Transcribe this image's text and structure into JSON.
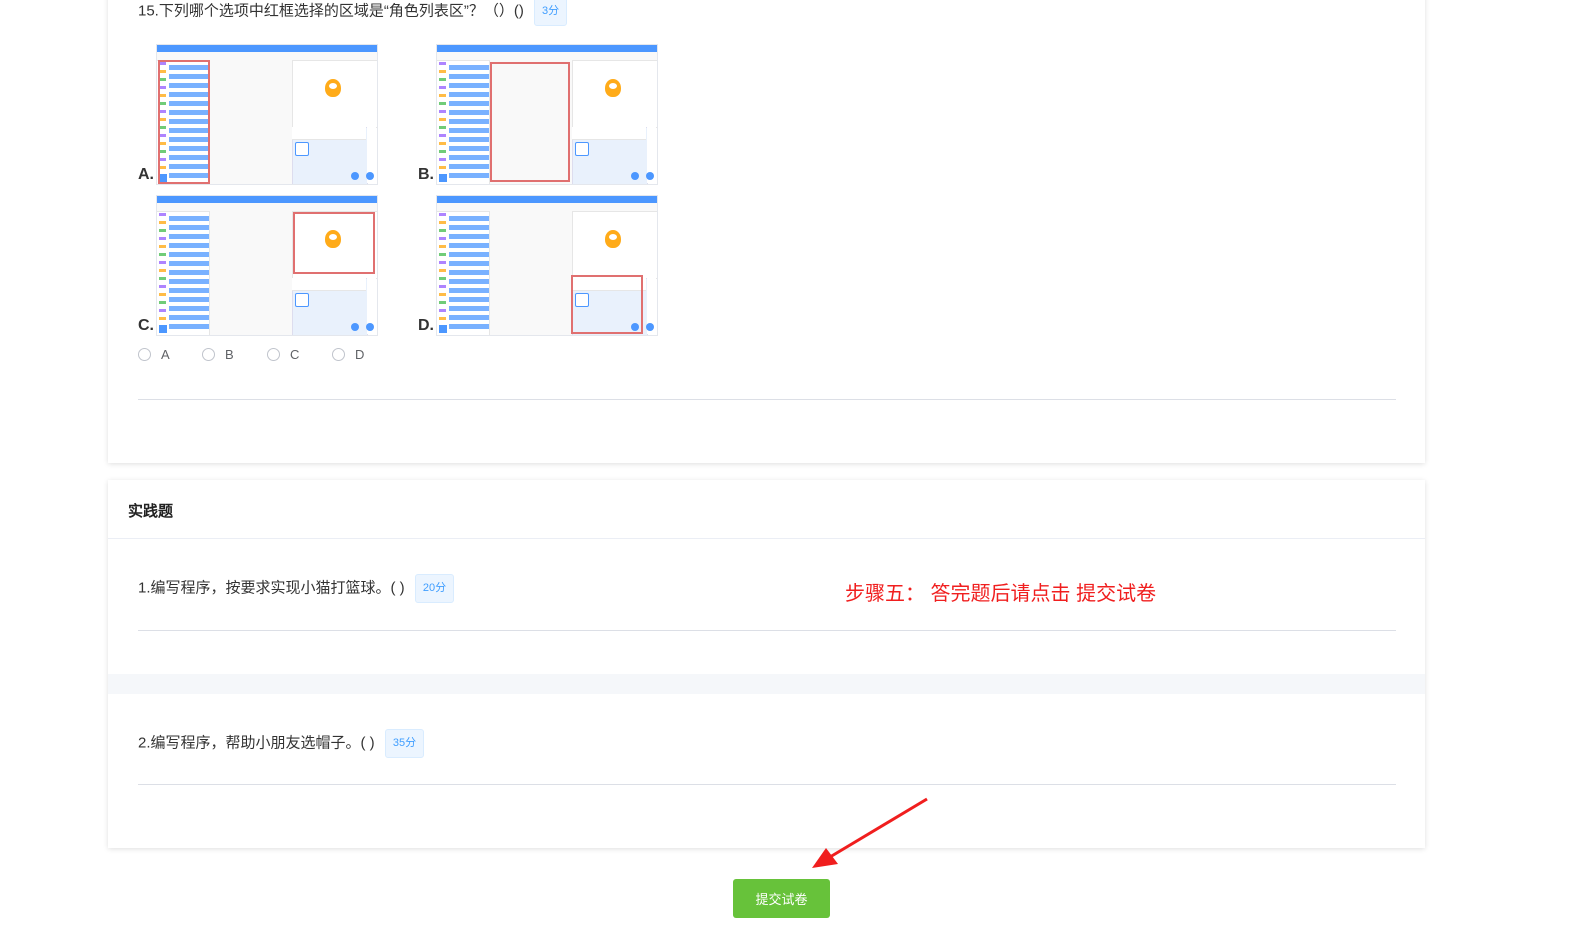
{
  "objective": {
    "question15": {
      "title": "15.下列哪个选项中红框选择的区域是“角色列表区”？（）()",
      "score": "3分",
      "image_options": [
        {
          "label": "A."
        },
        {
          "label": "B."
        },
        {
          "label": "C."
        },
        {
          "label": "D."
        }
      ],
      "radio_options": [
        "A",
        "B",
        "C",
        "D"
      ],
      "selected": null
    }
  },
  "practice": {
    "section_title": "实践题",
    "questions": [
      {
        "title": "1.编写程序，按要求实现小猫打篮球。( )",
        "score": "20分"
      },
      {
        "title": "2.编写程序，帮助小朋友选帽子。( )",
        "score": "35分"
      }
    ]
  },
  "annotation": {
    "text": "步骤五：  答完题后请点击 提交试卷",
    "color": "#f01e1e"
  },
  "submit": {
    "label": "提交试卷",
    "color": "#67c23a"
  }
}
